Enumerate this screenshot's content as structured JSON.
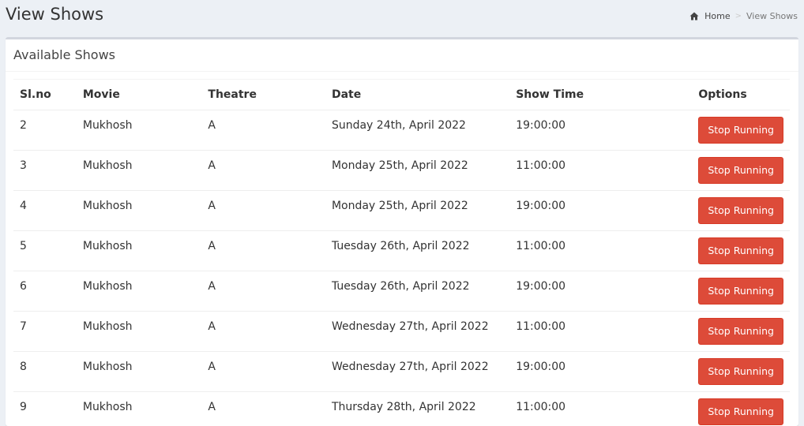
{
  "header": {
    "title": "View Shows",
    "breadcrumb": {
      "home_label": "Home",
      "home_icon": "home-icon",
      "separator": ">",
      "current": "View Shows"
    }
  },
  "box": {
    "title": "Available Shows"
  },
  "table": {
    "columns": [
      "Sl.no",
      "Movie",
      "Theatre",
      "Date",
      "Show Time",
      "Options"
    ],
    "rows": [
      {
        "slno": "2",
        "movie": "Mukhosh",
        "theatre": "A",
        "date": "Sunday 24th, April 2022",
        "time": "19:00:00",
        "option": "Stop Running"
      },
      {
        "slno": "3",
        "movie": "Mukhosh",
        "theatre": "A",
        "date": "Monday 25th, April 2022",
        "time": "11:00:00",
        "option": "Stop Running"
      },
      {
        "slno": "4",
        "movie": "Mukhosh",
        "theatre": "A",
        "date": "Monday 25th, April 2022",
        "time": "19:00:00",
        "option": "Stop Running"
      },
      {
        "slno": "5",
        "movie": "Mukhosh",
        "theatre": "A",
        "date": "Tuesday 26th, April 2022",
        "time": "11:00:00",
        "option": "Stop Running"
      },
      {
        "slno": "6",
        "movie": "Mukhosh",
        "theatre": "A",
        "date": "Tuesday 26th, April 2022",
        "time": "19:00:00",
        "option": "Stop Running"
      },
      {
        "slno": "7",
        "movie": "Mukhosh",
        "theatre": "A",
        "date": "Wednesday 27th, April 2022",
        "time": "11:00:00",
        "option": "Stop Running"
      },
      {
        "slno": "8",
        "movie": "Mukhosh",
        "theatre": "A",
        "date": "Wednesday 27th, April 2022",
        "time": "19:00:00",
        "option": "Stop Running"
      },
      {
        "slno": "9",
        "movie": "Mukhosh",
        "theatre": "A",
        "date": "Thursday 28th, April 2022",
        "time": "11:00:00",
        "option": "Stop Running"
      }
    ]
  },
  "colors": {
    "page_bg": "#ecf0f5",
    "danger": "#dd4b39",
    "box_border": "#d2d6de"
  }
}
